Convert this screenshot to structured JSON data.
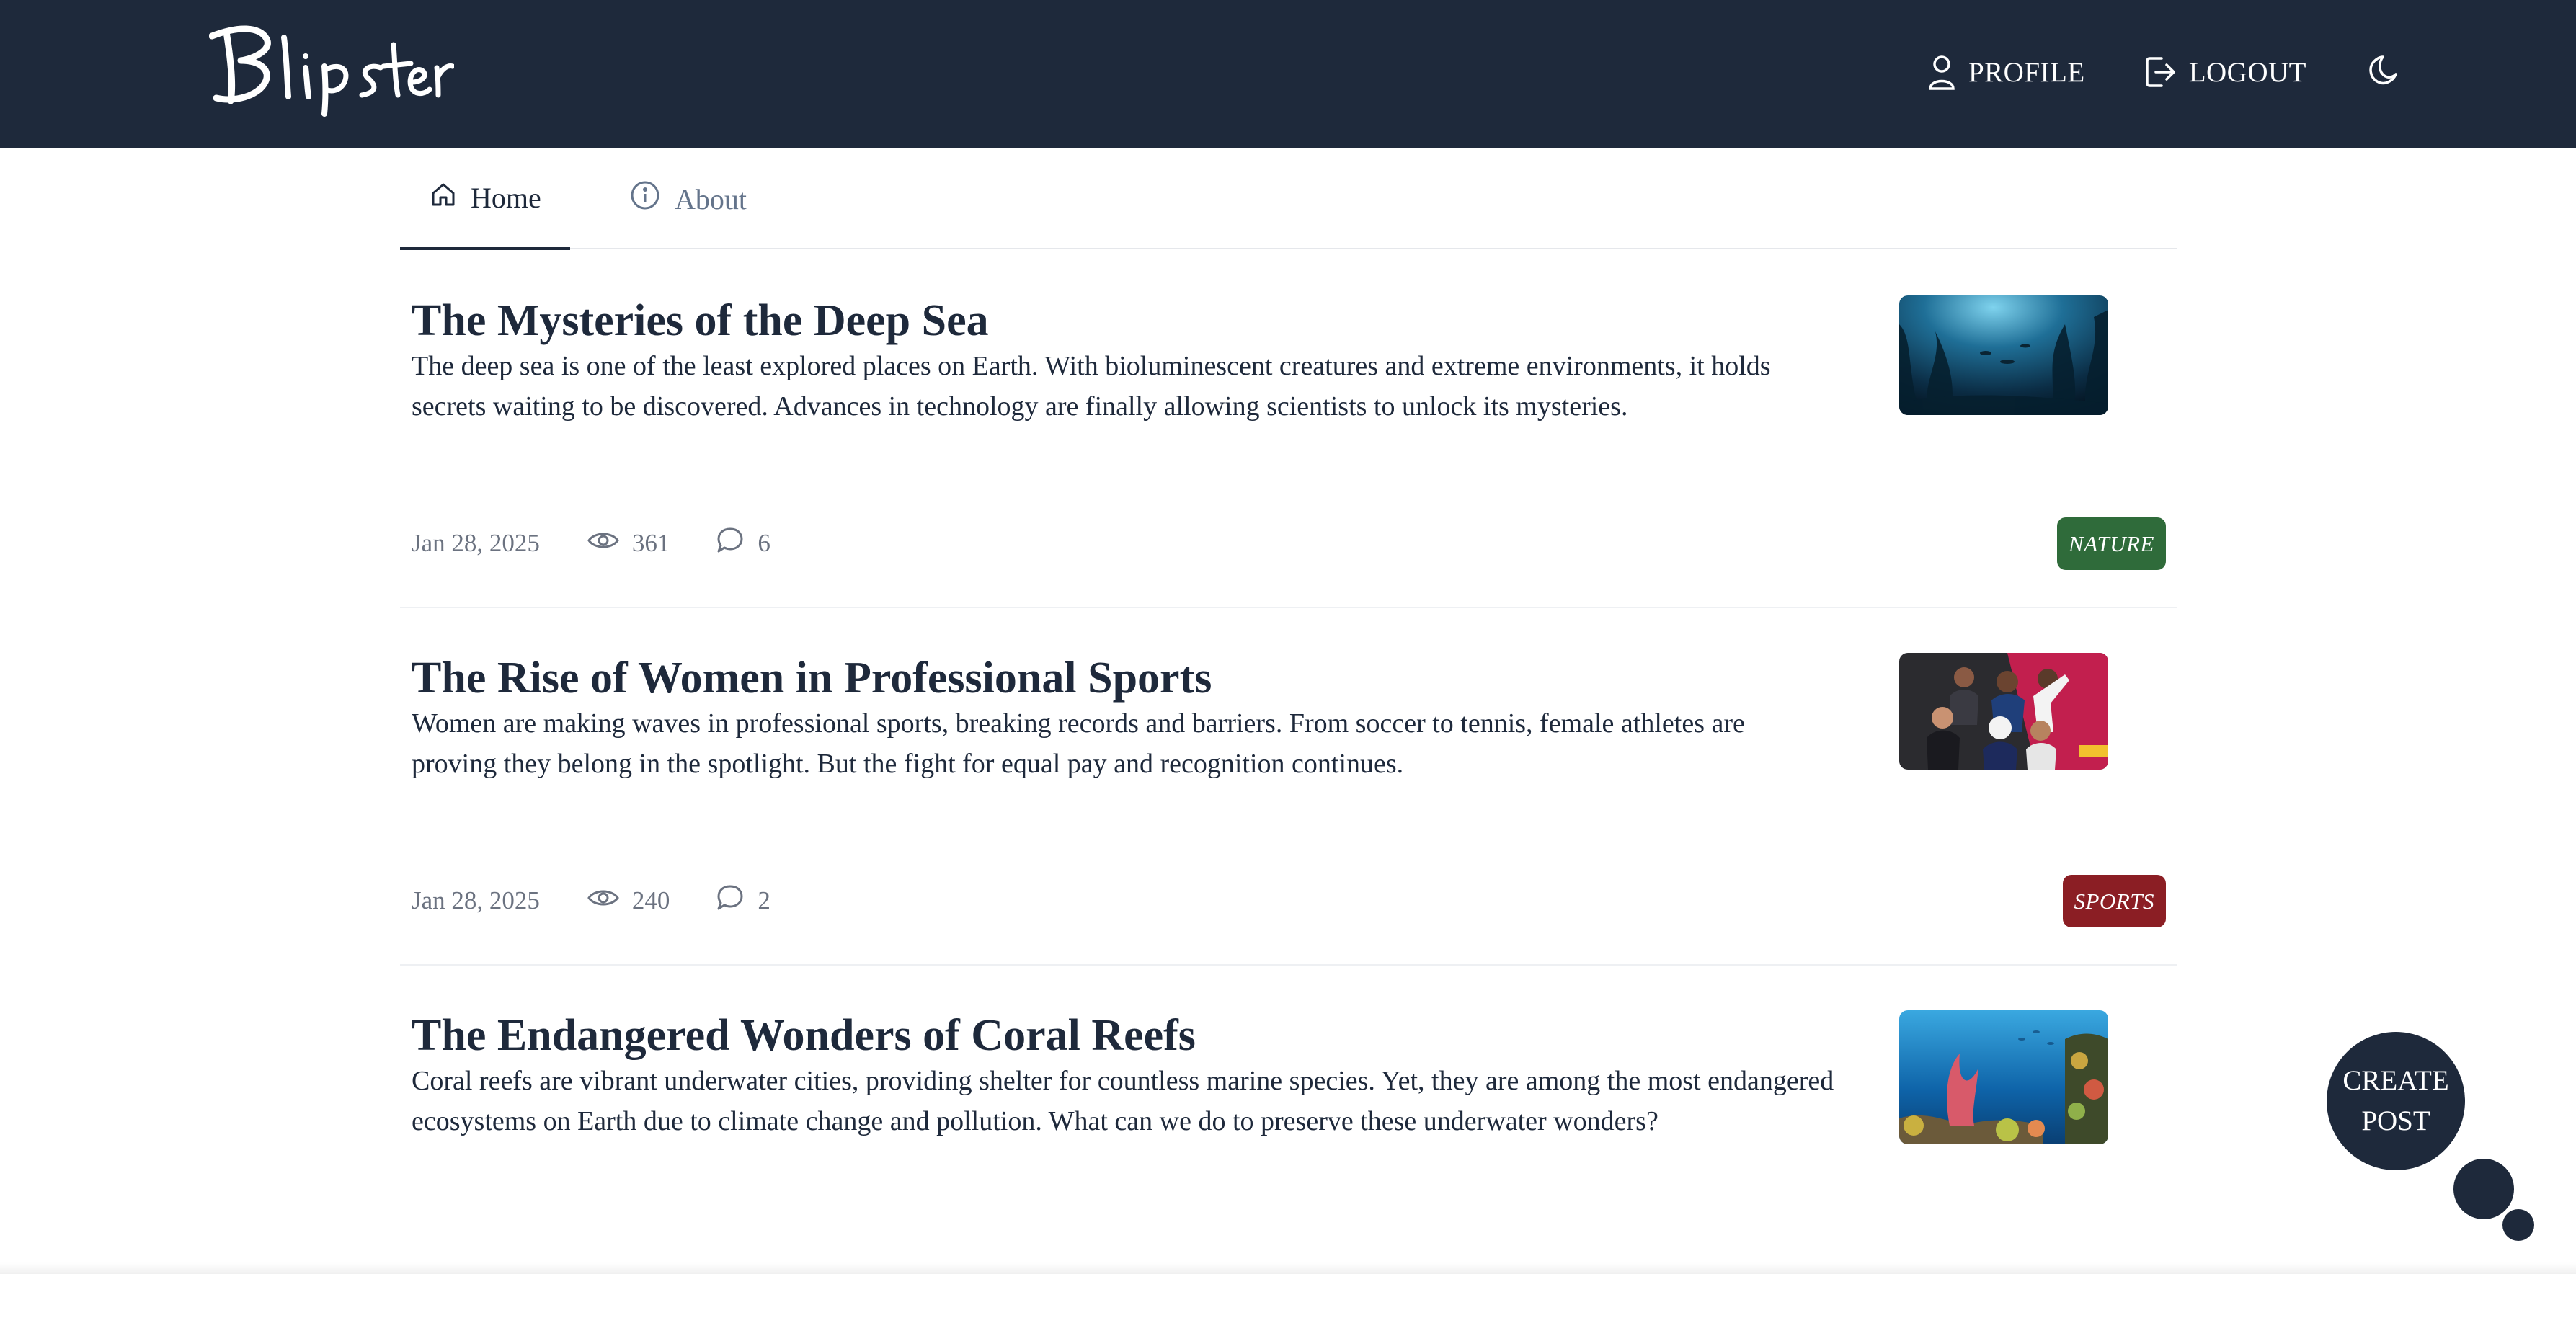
{
  "header": {
    "logo_text": "Blipster",
    "profile_label": "PROFILE",
    "logout_label": "LOGOUT",
    "theme_icon": "moon-icon"
  },
  "tabs": [
    {
      "label": "Home",
      "icon": "home-icon",
      "active": true
    },
    {
      "label": "About",
      "icon": "info-icon",
      "active": false
    }
  ],
  "posts": [
    {
      "title": "The Mysteries of the Deep Sea",
      "excerpt": "The deep sea is one of the least explored places on Earth. With bioluminescent creatures and extreme environments, it holds secrets waiting to be discovered. Advances in technology are finally allowing scientists to unlock its mysteries.",
      "date": "Jan 28, 2025",
      "views": "361",
      "comments": "6",
      "tag": "NATURE",
      "tag_color": "#2f6b3a"
    },
    {
      "title": "The Rise of Women in Professional Sports",
      "excerpt": "Women are making waves in professional sports, breaking records and barriers. From soccer to tennis, female athletes are proving they belong in the spotlight. But the fight for equal pay and recognition continues.",
      "date": "Jan 28, 2025",
      "views": "240",
      "comments": "2",
      "tag": "SPORTS",
      "tag_color": "#8b1e24"
    },
    {
      "title": "The Endangered Wonders of Coral Reefs",
      "excerpt": "Coral reefs are vibrant underwater cities, providing shelter for countless marine species. Yet, they are among the most endangered ecosystems on Earth due to climate change and pollution. What can we do to preserve these underwater wonders?"
    }
  ],
  "fab": {
    "label_line1": "CREATE",
    "label_line2": "POST"
  },
  "colors": {
    "navbar": "#1e293b",
    "text": "#1e293b",
    "muted": "#6b7280",
    "nature_tag": "#2f6b3a",
    "sports_tag": "#8b1e24"
  }
}
